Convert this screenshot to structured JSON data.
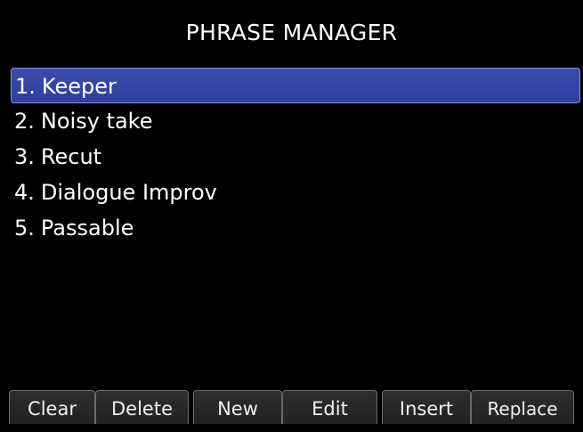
{
  "title": "PHRASE MANAGER",
  "phrases": [
    {
      "number": "1.",
      "label": "Keeper",
      "selected": true
    },
    {
      "number": "2.",
      "label": "Noisy take",
      "selected": false
    },
    {
      "number": "3.",
      "label": "Recut",
      "selected": false
    },
    {
      "number": "4.",
      "label": "Dialogue Improv",
      "selected": false
    },
    {
      "number": "5.",
      "label": "Passable",
      "selected": false
    }
  ],
  "softkeys": {
    "clear": "Clear",
    "delete": "Delete",
    "new": "New",
    "edit": "Edit",
    "insert": "Insert",
    "replace": "Replace"
  },
  "colors": {
    "background": "#000000",
    "selection": "#3446a8",
    "text": "#ffffff",
    "softkey_border": "#6b6b6b"
  }
}
